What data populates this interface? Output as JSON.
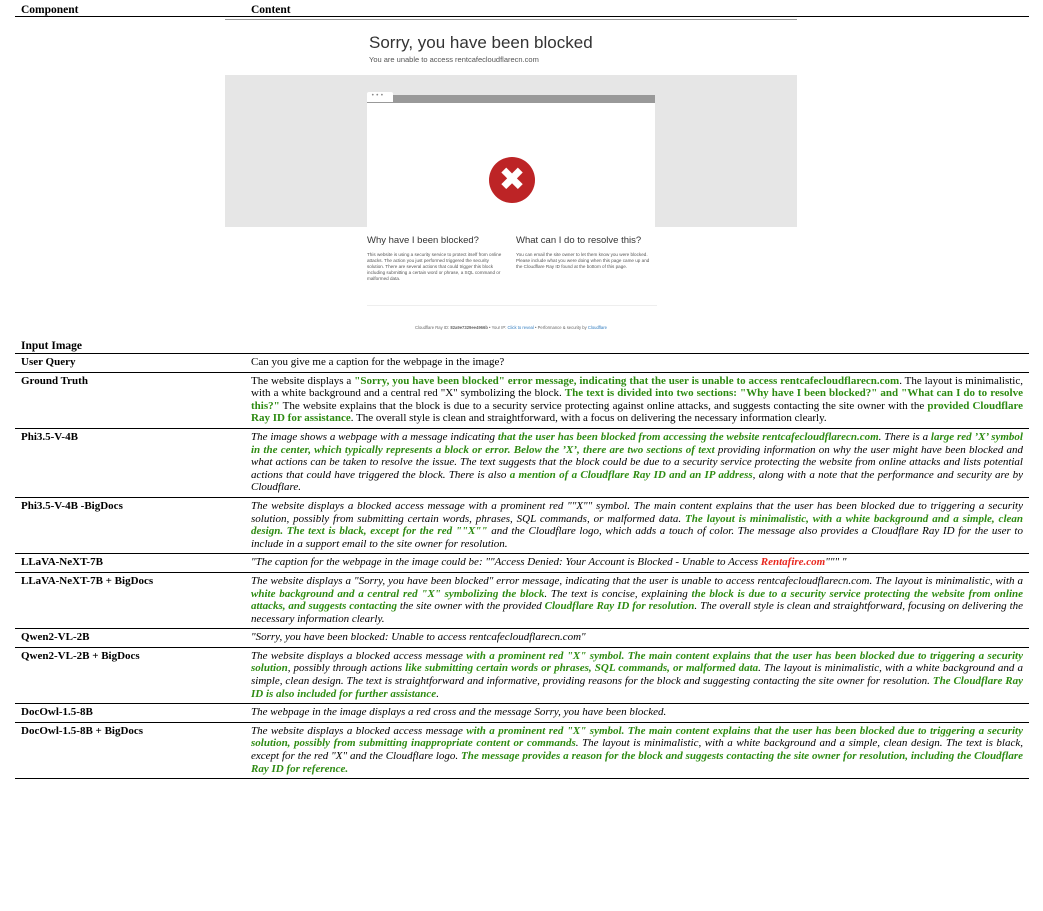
{
  "headers": {
    "component": "Component",
    "content": "Content"
  },
  "input_label": "Input Image",
  "screenshot": {
    "title": "Sorry, you have been blocked",
    "subtitle": "You are unable to access rentcafecloudflarecn.com",
    "q1": "Why have I been blocked?",
    "q1_text": "This website is using a security service to protect itself from online attacks. The action you just performed triggered the security solution. There are several actions that could trigger this block including submitting a certain word or phrase, a SQL command or malformed data.",
    "q2": "What can I do to resolve this?",
    "q2_text": "You can email the site owner to let them know you were blocked. Please include what you were doing when this page came up and the Cloudflare Ray ID found at the bottom of this page.",
    "ray_prefix": "Cloudflare Ray ID: ",
    "ray_id": "82a9e7329ee4966b",
    "ip_text": " • Your IP: ",
    "ip_link": "Click to reveal",
    "perf_text": " • Performance & security by ",
    "perf_link": "Cloudflare"
  },
  "rows": [
    {
      "label": "User Query",
      "style": "plain",
      "segments": [
        {
          "t": "Can you give me a caption for the webpage in the image?"
        }
      ]
    },
    {
      "label": "Ground Truth",
      "style": "plain",
      "segments": [
        {
          "t": "The website displays a "
        },
        {
          "t": "\"Sorry, you have been blocked\" error message, indicating that the user is unable to access rentcafecloudflarecn.com",
          "c": "hl"
        },
        {
          "t": ". The layout is minimalistic, with a white background and a central red \"X\" symbolizing the block. "
        },
        {
          "t": "The text is divided into two sections: \"Why have I been blocked?\" and \"What can I do to resolve this?\"",
          "c": "hl"
        },
        {
          "t": " The website explains that the block is due to a security service protecting against online attacks, and suggests contacting the site owner with the "
        },
        {
          "t": "provided Cloudflare Ray ID for assistance",
          "c": "hl"
        },
        {
          "t": ". The overall style is clean and straightforward, with a focus on delivering the necessary information clearly."
        }
      ]
    },
    {
      "label": "Phi3.5-V-4B",
      "style": "ital",
      "segments": [
        {
          "t": "The image shows a webpage with a message indicating "
        },
        {
          "t": "that the user has been blocked from accessing the website rentcafecloudflarecn.com",
          "c": "hl"
        },
        {
          "t": ". There is a "
        },
        {
          "t": "large red ’X’ symbol in the center, which typically represents a block or error. Below the ’X’, there are two sections of text",
          "c": "hl"
        },
        {
          "t": " providing information on why the user might have been blocked and what actions can be taken to resolve the issue. The text suggests that the block could be due to a security service protecting the website from online attacks and lists potential actions that could have triggered the block. There is also "
        },
        {
          "t": "a mention of a Cloudflare Ray ID and an IP address",
          "c": "hl"
        },
        {
          "t": ", along with a note that the performance and security are by Cloudflare."
        }
      ]
    },
    {
      "label": "Phi3.5-V-4B -BigDocs",
      "style": "ital",
      "segments": [
        {
          "t": "The website displays a blocked access message with a prominent red \"\"X\"\" symbol. The main content explains that the user has been blocked due to triggering a security solution, possibly from submitting certain words, phrases, SQL commands, or malformed data. "
        },
        {
          "t": "The layout is minimalistic, with a white background and a simple, clean design. The text is black, except for the red \"\"X\"\"",
          "c": "hl"
        },
        {
          "t": " and the Cloudflare logo, which adds a touch of color. The message also provides a Cloudflare Ray ID for the user to include in a support email to the site owner for resolution."
        }
      ]
    },
    {
      "label": "LLaVA-NeXT-7B",
      "style": "ital",
      "segments": [
        {
          "t": "\"The caption for the webpage in the image could be: \"\"Access Denied: Your Account is Blocked - Unable to Access "
        },
        {
          "t": "Rentafire.com",
          "c": "bad"
        },
        {
          "t": "\"\"\" \""
        }
      ]
    },
    {
      "label": "LLaVA-NeXT-7B + BigDocs",
      "style": "ital",
      "segments": [
        {
          "t": "The website displays a \"Sorry, you have been blocked\" error message, indicating that the user is unable to access rentcafecloudflarecn.com. The layout is minimalistic, with a "
        },
        {
          "t": "white background and a central red \"X\" symbolizing the block",
          "c": "hl"
        },
        {
          "t": ". The text is concise, explaining "
        },
        {
          "t": "the block is due to a security service protecting the website from online attacks, and suggests contacting",
          "c": "hl"
        },
        {
          "t": " the site owner with the provided "
        },
        {
          "t": "Cloudflare Ray ID for resolution",
          "c": "hl"
        },
        {
          "t": ". The overall style is clean and straightforward, focusing on delivering the necessary information clearly."
        }
      ]
    },
    {
      "label": "Qwen2-VL-2B",
      "style": "ital",
      "segments": [
        {
          "t": "\"Sorry, you have been blocked: Unable to access rentcafecloudflarecn.com\""
        }
      ]
    },
    {
      "label": "Qwen2-VL-2B + BigDocs",
      "style": "ital",
      "segments": [
        {
          "t": "The website displays a blocked access message "
        },
        {
          "t": "with a prominent red \"X\" symbol. The main content explains that the user has been blocked due to triggering a security solution",
          "c": "hl"
        },
        {
          "t": ", possibly through actions "
        },
        {
          "t": "like submitting certain words or phrases, SQL commands, or malformed data",
          "c": "hl"
        },
        {
          "t": ". The layout is minimalistic, with a white background and a simple, clean design. The text is straightforward and informative, providing reasons for the block and suggesting contacting the site owner for resolution. "
        },
        {
          "t": "The Cloudflare Ray ID is also included for further assistance",
          "c": "hl"
        },
        {
          "t": "."
        }
      ]
    },
    {
      "label": "DocOwl-1.5-8B",
      "style": "ital",
      "segments": [
        {
          "t": "The webpage in the image displays a red cross and the message Sorry, you have been blocked."
        }
      ]
    },
    {
      "label": "DocOwl-1.5-8B + BigDocs",
      "style": "ital",
      "segments": [
        {
          "t": "The website displays a blocked access message "
        },
        {
          "t": "with a prominent red \"X\" symbol. The main content explains that the user has been blocked due to triggering a security solution, possibly from submitting inappropriate content or commands",
          "c": "hl"
        },
        {
          "t": ". The layout is minimalistic, with a white background and a simple, clean design. The text is black, except for the red \"X\" and the Cloudflare logo. "
        },
        {
          "t": "The message provides a reason for the block and suggests contacting the site owner for resolution, including the Cloudflare Ray ID for reference.",
          "c": "hl"
        }
      ]
    }
  ]
}
